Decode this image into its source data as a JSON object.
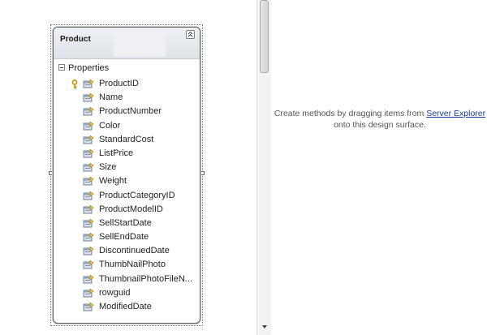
{
  "entity": {
    "title": "Product",
    "section_label": "Properties",
    "properties": [
      {
        "name": "ProductID",
        "key": true
      },
      {
        "name": "Name",
        "key": false
      },
      {
        "name": "ProductNumber",
        "key": false
      },
      {
        "name": "Color",
        "key": false
      },
      {
        "name": "StandardCost",
        "key": false
      },
      {
        "name": "ListPrice",
        "key": false
      },
      {
        "name": "Size",
        "key": false
      },
      {
        "name": "Weight",
        "key": false
      },
      {
        "name": "ProductCategoryID",
        "key": false
      },
      {
        "name": "ProductModelID",
        "key": false
      },
      {
        "name": "SellStartDate",
        "key": false
      },
      {
        "name": "SellEndDate",
        "key": false
      },
      {
        "name": "DiscontinuedDate",
        "key": false
      },
      {
        "name": "ThumbNailPhoto",
        "key": false
      },
      {
        "name": "ThumbnailPhotoFileN...",
        "key": false
      },
      {
        "name": "rowguid",
        "key": false
      },
      {
        "name": "ModifiedDate",
        "key": false
      }
    ]
  },
  "methods_pane": {
    "hint_before": "Create methods by dragging items from ",
    "hint_link": "Server Explorer",
    "hint_after": " onto this design surface."
  },
  "icons": {
    "property": "property-icon",
    "key": "key-icon",
    "collapse": "collapse-up-icon",
    "scroll_down": "scroll-down-arrow-icon"
  },
  "colors": {
    "link": "#1a3e9a",
    "header_bg": "#dfe4ea",
    "key_gold": "#d9a400"
  }
}
